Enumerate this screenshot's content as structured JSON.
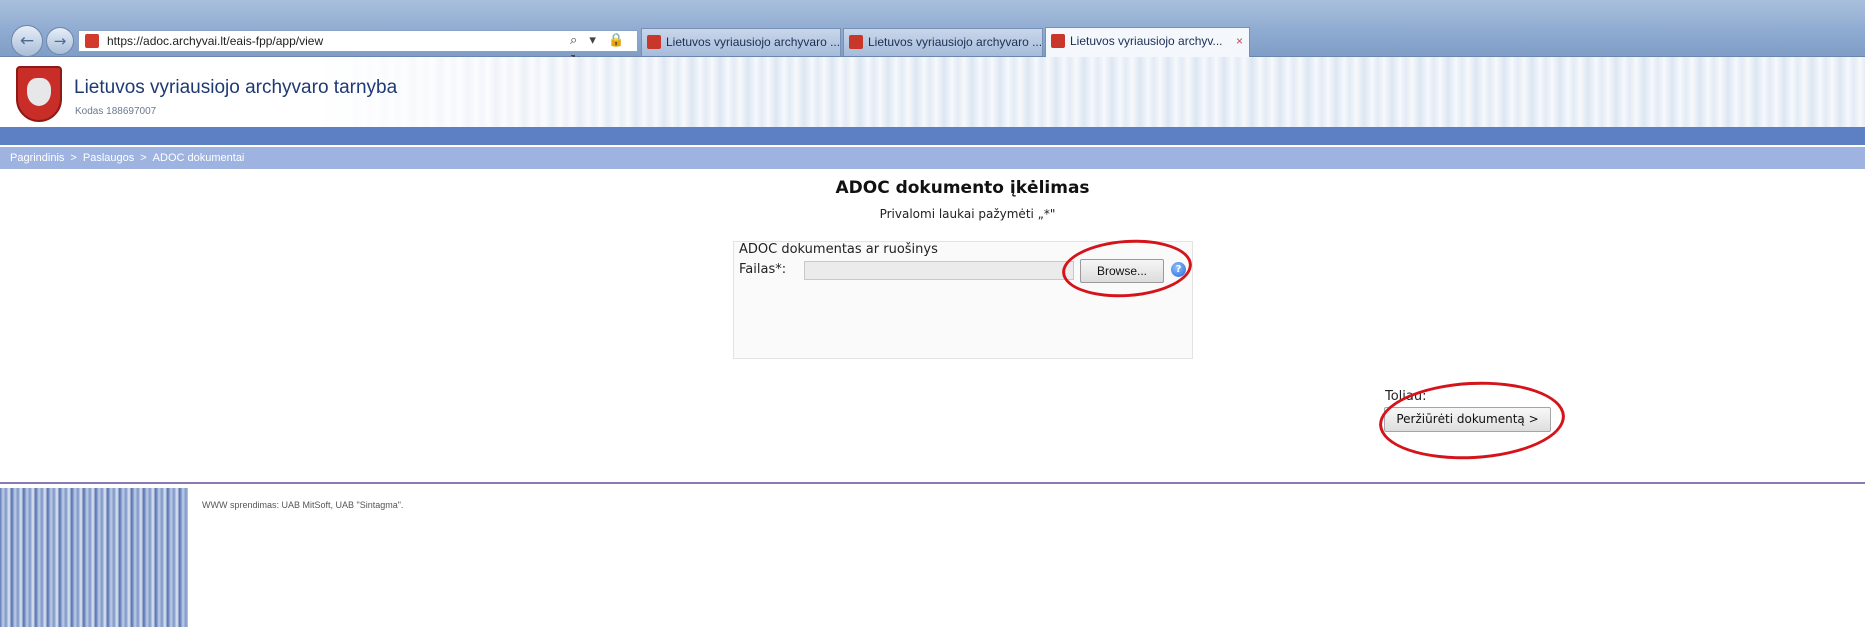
{
  "browser": {
    "url": "https://adoc.archyvai.lt/eais-fpp/app/view",
    "address_tools": "⌕ ▾ 🔒 ↻",
    "tabs": [
      {
        "title": "Lietuvos vyriausiojo archyvaro ..."
      },
      {
        "title": "Lietuvos vyriausiojo archyvaro ..."
      },
      {
        "title": "Lietuvos vyriausiojo archyv...",
        "close": "×"
      }
    ],
    "active_tab_index": 2
  },
  "header": {
    "org_name": "Lietuvos vyriausiojo archyvaro tarnyba",
    "org_code": "Kodas 188697007",
    "logo_icon": "coat-of-arms-icon"
  },
  "breadcrumb": {
    "items": [
      "Pagrindinis",
      "Paslaugos",
      "ADOC dokumentai"
    ],
    "separator": ">"
  },
  "main": {
    "title": "ADOC dokumento įkėlimas",
    "required_note": "Privalomi laukai pažymėti „*\"",
    "fieldset_legend": "ADOC dokumentas ar ruošinys",
    "file_label": "Failas*:",
    "file_value": "",
    "browse_label": "Browse...",
    "help_icon": "question-icon",
    "next_label": "Toliau:",
    "view_button_label": "Peržiūrėti dokumentą >"
  },
  "footer": {
    "text": "WWW sprendimas: UAB MitSoft, UAB \"Sintagma\"."
  },
  "colors": {
    "breadcrumb_bg": "#9fb3e1",
    "blue_strip": "#5d80c5",
    "annotation": "#d4141a"
  }
}
